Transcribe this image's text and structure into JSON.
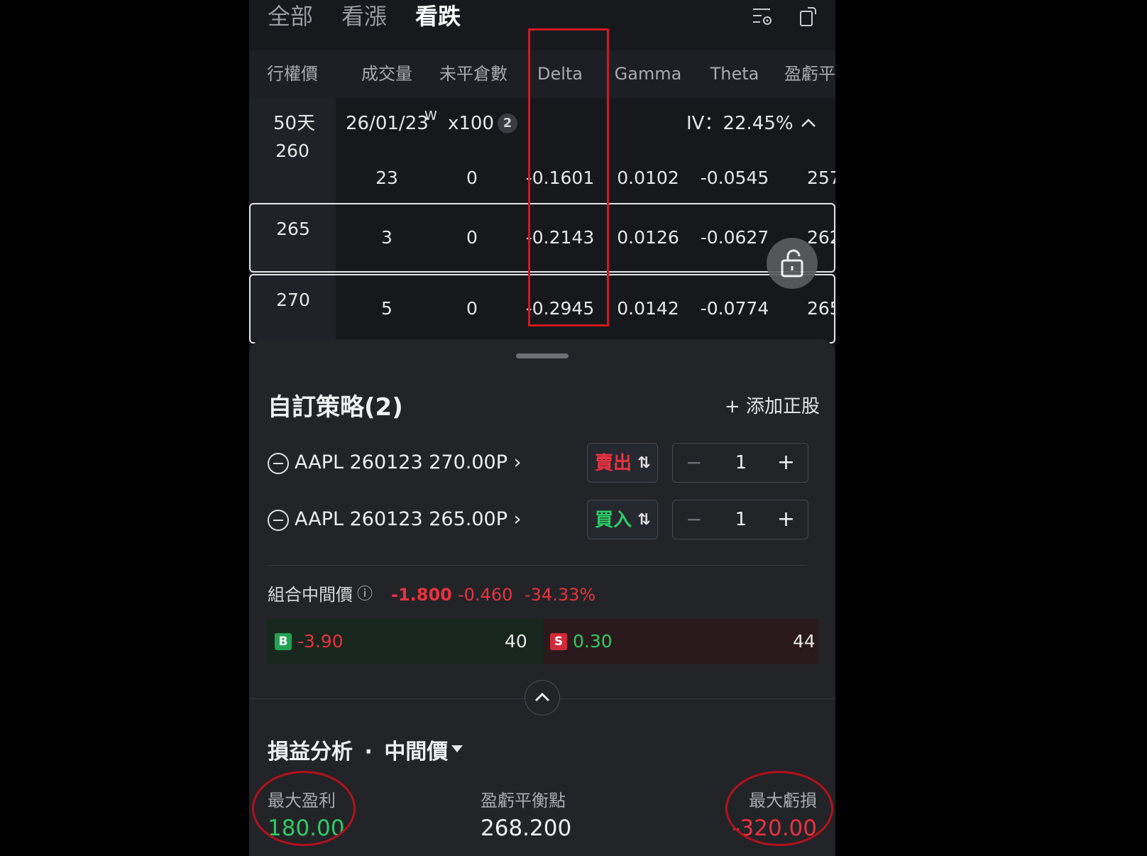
{
  "tabs": [
    {
      "label": "全部",
      "active": false
    },
    {
      "label": "看漲",
      "active": false
    },
    {
      "label": "看跌",
      "active": true
    }
  ],
  "top_icons": [
    "list-settings-icon",
    "rotate-screen-icon"
  ],
  "columns": [
    "行權價",
    "成交量",
    "未平倉數",
    "Delta",
    "Gamma",
    "Theta",
    "盈虧平"
  ],
  "expiry": {
    "days": "50天",
    "date": "26/01/23",
    "weekly_mark": "W",
    "multiplier": "x100",
    "badge": "2",
    "iv": "IV：22.45%"
  },
  "rows": [
    {
      "strike": "260",
      "volume": "23",
      "oi": "0",
      "delta": "-0.1601",
      "gamma": "0.0102",
      "theta": "-0.0545",
      "breakeven": "257"
    },
    {
      "strike": "265",
      "volume": "3",
      "oi": "0",
      "delta": "-0.2143",
      "gamma": "0.0126",
      "theta": "-0.0627",
      "breakeven": "262"
    },
    {
      "strike": "270",
      "volume": "5",
      "oi": "0",
      "delta": "-0.2945",
      "gamma": "0.0142",
      "theta": "-0.0774",
      "breakeven": "265"
    }
  ],
  "strategy": {
    "title": "自訂策略(2)",
    "add_stock": "添加正股",
    "legs": [
      {
        "name": "AAPL 260123 270.00P",
        "side": "賣出",
        "side_color": "#e8323f",
        "qty": "1"
      },
      {
        "name": "AAPL 260123 265.00P",
        "side": "買入",
        "side_color": "#2ecc63",
        "qty": "1"
      }
    ],
    "combo_label": "組合中間價",
    "combo_price": "-1.800",
    "combo_change": "-0.460",
    "combo_pct": "-34.33%",
    "bid_tag": "B",
    "bid_price": "-3.90",
    "bid_size": "40",
    "ask_tag": "S",
    "ask_price": "0.30",
    "ask_size": "44"
  },
  "pl": {
    "title": "損益分析",
    "dot": "·",
    "mode": "中間價",
    "max_profit_label": "最大盈利",
    "max_profit": "180.00",
    "breakeven_label": "盈虧平衡點",
    "breakeven": "268.200",
    "max_loss_label": "最大虧損",
    "max_loss": "-320.00"
  },
  "colors": {
    "red": "#e8323f",
    "green": "#2ecc63",
    "annotation": "#d0191f"
  }
}
